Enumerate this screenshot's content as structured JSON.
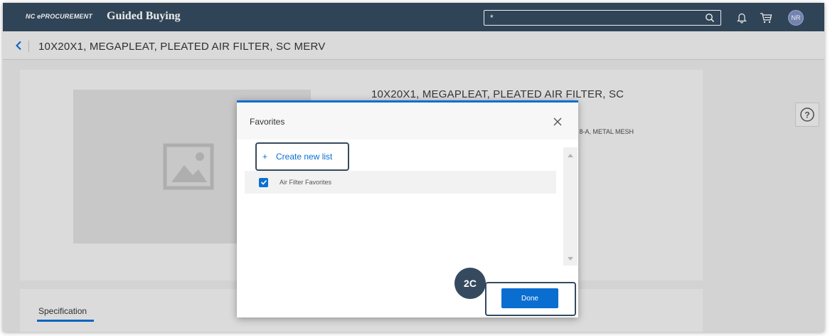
{
  "shell": {
    "brand_small": "NC ePROCUREMENT",
    "brand_title": "Guided Buying",
    "search_value": "*",
    "avatar_initials": "NR",
    "icons": {
      "search": "search-icon",
      "notifications": "bell-icon",
      "cart": "cart-icon"
    }
  },
  "subheader": {
    "title": "10X20X1, MEGAPLEAT, PLEATED AIR FILTER, SC MERV"
  },
  "product": {
    "name": "10X20X1, MEGAPLEAT, PLEATED AIR FILTER, SC",
    "description_fragment": "V 8-A, METAL MESH",
    "help_symbol": "?"
  },
  "specification": {
    "tab_label": "Specification"
  },
  "dialog": {
    "title": "Favorites",
    "create_new_list_plus": "+",
    "create_new_list_label": "Create new list",
    "lists": [
      {
        "label": "Air Filter Favorites",
        "checked": true
      }
    ],
    "done_label": "Done"
  },
  "annotation": {
    "step_badge": "2C"
  },
  "colors": {
    "shellbar": "#354a5f",
    "accent": "#0a6ed1",
    "avatar": "#7c8fbf"
  }
}
